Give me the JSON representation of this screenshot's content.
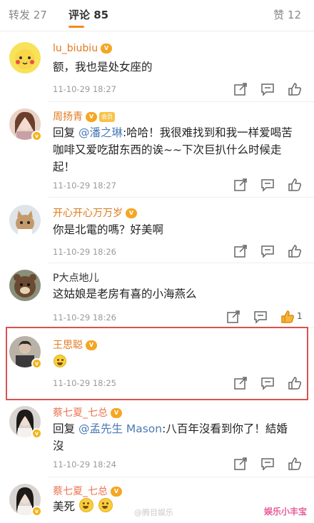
{
  "tabs": {
    "reposts": "转发 27",
    "comments": "评论 85",
    "likes": "赞 12"
  },
  "comments": [
    {
      "username": "lu_biubiu",
      "text": "额，我也是处女座的",
      "time": "11-10-29 18:27"
    },
    {
      "username": "周扬青",
      "reply_prefix": "回复 ",
      "mention": "@潘之琳",
      "text_1": ":哈哈！我很难找到和我一样爱喝苦",
      "text_2": "咖啡又爱吃甜东西的诶~~下次巨扒什么时候走",
      "text_3": "起！",
      "time": "11-10-29 18:27",
      "member_badge": "会员"
    },
    {
      "username": "开心开心万万岁",
      "text": "你是北電的嗎？好美啊",
      "time": "11-10-29 18:26"
    },
    {
      "username": "P大点地儿",
      "text": "这姑娘是老房有喜的小海燕么",
      "time": "11-10-29 18:26",
      "like_count": "1"
    },
    {
      "username": "王思聪",
      "time": "11-10-29 18:25"
    },
    {
      "username": "蔡七夏_七总",
      "reply_prefix": "回复 ",
      "mention": "@孟先生 Mason",
      "text_1": ":八百年沒看到你了！結婚",
      "text_2": "沒",
      "time": "11-10-29 18:24"
    },
    {
      "username": "蔡七夏_七总",
      "text": "美死"
    }
  ],
  "watermark": {
    "left": "@腾目娱乐",
    "right": "娱乐小丰宝"
  },
  "colors": {
    "tab_accent": "#f78a1d",
    "username": "#e07a1f",
    "mention": "#4a7ab5",
    "highlight_border": "#d9534f"
  }
}
